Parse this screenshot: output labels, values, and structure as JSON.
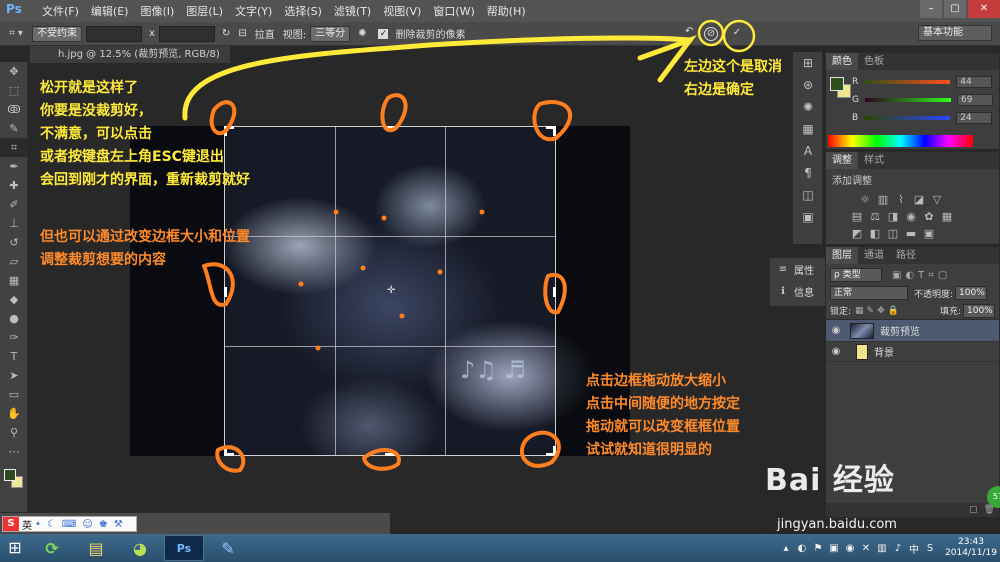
{
  "app": {
    "logo": "Ps",
    "menu": [
      "文件(F)",
      "编辑(E)",
      "图像(I)",
      "图层(L)",
      "文字(Y)",
      "选择(S)",
      "滤镜(T)",
      "视图(V)",
      "窗口(W)",
      "帮助(H)"
    ],
    "window_controls": [
      "–",
      "▢",
      "✕"
    ]
  },
  "options": {
    "ratio_select": "不受约束",
    "x_sep": "x",
    "straighten": "拉直",
    "view_label": "视图:",
    "view_select": "三等分",
    "delete_pixels_check": "✓",
    "delete_pixels": "删除裁剪的像素",
    "cancel_glyph": "⊘",
    "commit_glyph": "✓",
    "workspace": "基本功能"
  },
  "document": {
    "tab_title": "h.jpg @ 12.5% (裁剪预览, RGB/8)"
  },
  "annotations": {
    "left": [
      "松开就是这样了",
      "你要是没裁剪好，",
      "不满意，可以点击",
      "或者按键盘左上角ESC键退出",
      "会回到刚才的界面，重新裁剪就好"
    ],
    "left_orange": [
      "但也可以通过改变边框大小和位置",
      "调整裁剪想要的内容"
    ],
    "top_right": [
      "左边这个是取消",
      "右边是确定"
    ],
    "bottom_right": [
      "点击边框拖动放大缩小",
      "点击中间随便的地方按定",
      "拖动就可以改变框框位置",
      "试试就知道很明显的"
    ]
  },
  "colors": {
    "annotation_yellow": "#ffea3a",
    "annotation_orange": "#ff8a2a",
    "accent_blue": "#4d5970"
  },
  "color_panel": {
    "tabs": [
      "颜色",
      "色板"
    ],
    "rows": [
      {
        "label": "R",
        "value": "44"
      },
      {
        "label": "G",
        "value": "69"
      },
      {
        "label": "B",
        "value": "24"
      }
    ]
  },
  "adjust_panel": {
    "tabs": [
      "调整",
      "样式"
    ],
    "title": "添加调整"
  },
  "mini_panel": {
    "items": [
      {
        "icon": "≡",
        "label": "属性"
      },
      {
        "icon": "ℹ",
        "label": "信息"
      }
    ]
  },
  "layers_panel": {
    "tabs": [
      "图层",
      "通道",
      "路径"
    ],
    "filter": "ρ 类型",
    "blend_mode": "正常",
    "opacity_label": "不透明度:",
    "opacity": "100%",
    "lock_label": "锁定:",
    "fill_label": "填充:",
    "fill": "100%",
    "layers": [
      {
        "name": "裁剪预览",
        "selected": true
      },
      {
        "name": "背景",
        "selected": false
      }
    ]
  },
  "ime": {
    "logo": "S",
    "mode": "英"
  },
  "taskbar": {
    "ps_label": "Ps",
    "time": "23:43",
    "date": "2014/11/19"
  },
  "watermark": {
    "brand": "Bai 经验",
    "url": "jingyan.baidu.com",
    "badge": "57"
  }
}
